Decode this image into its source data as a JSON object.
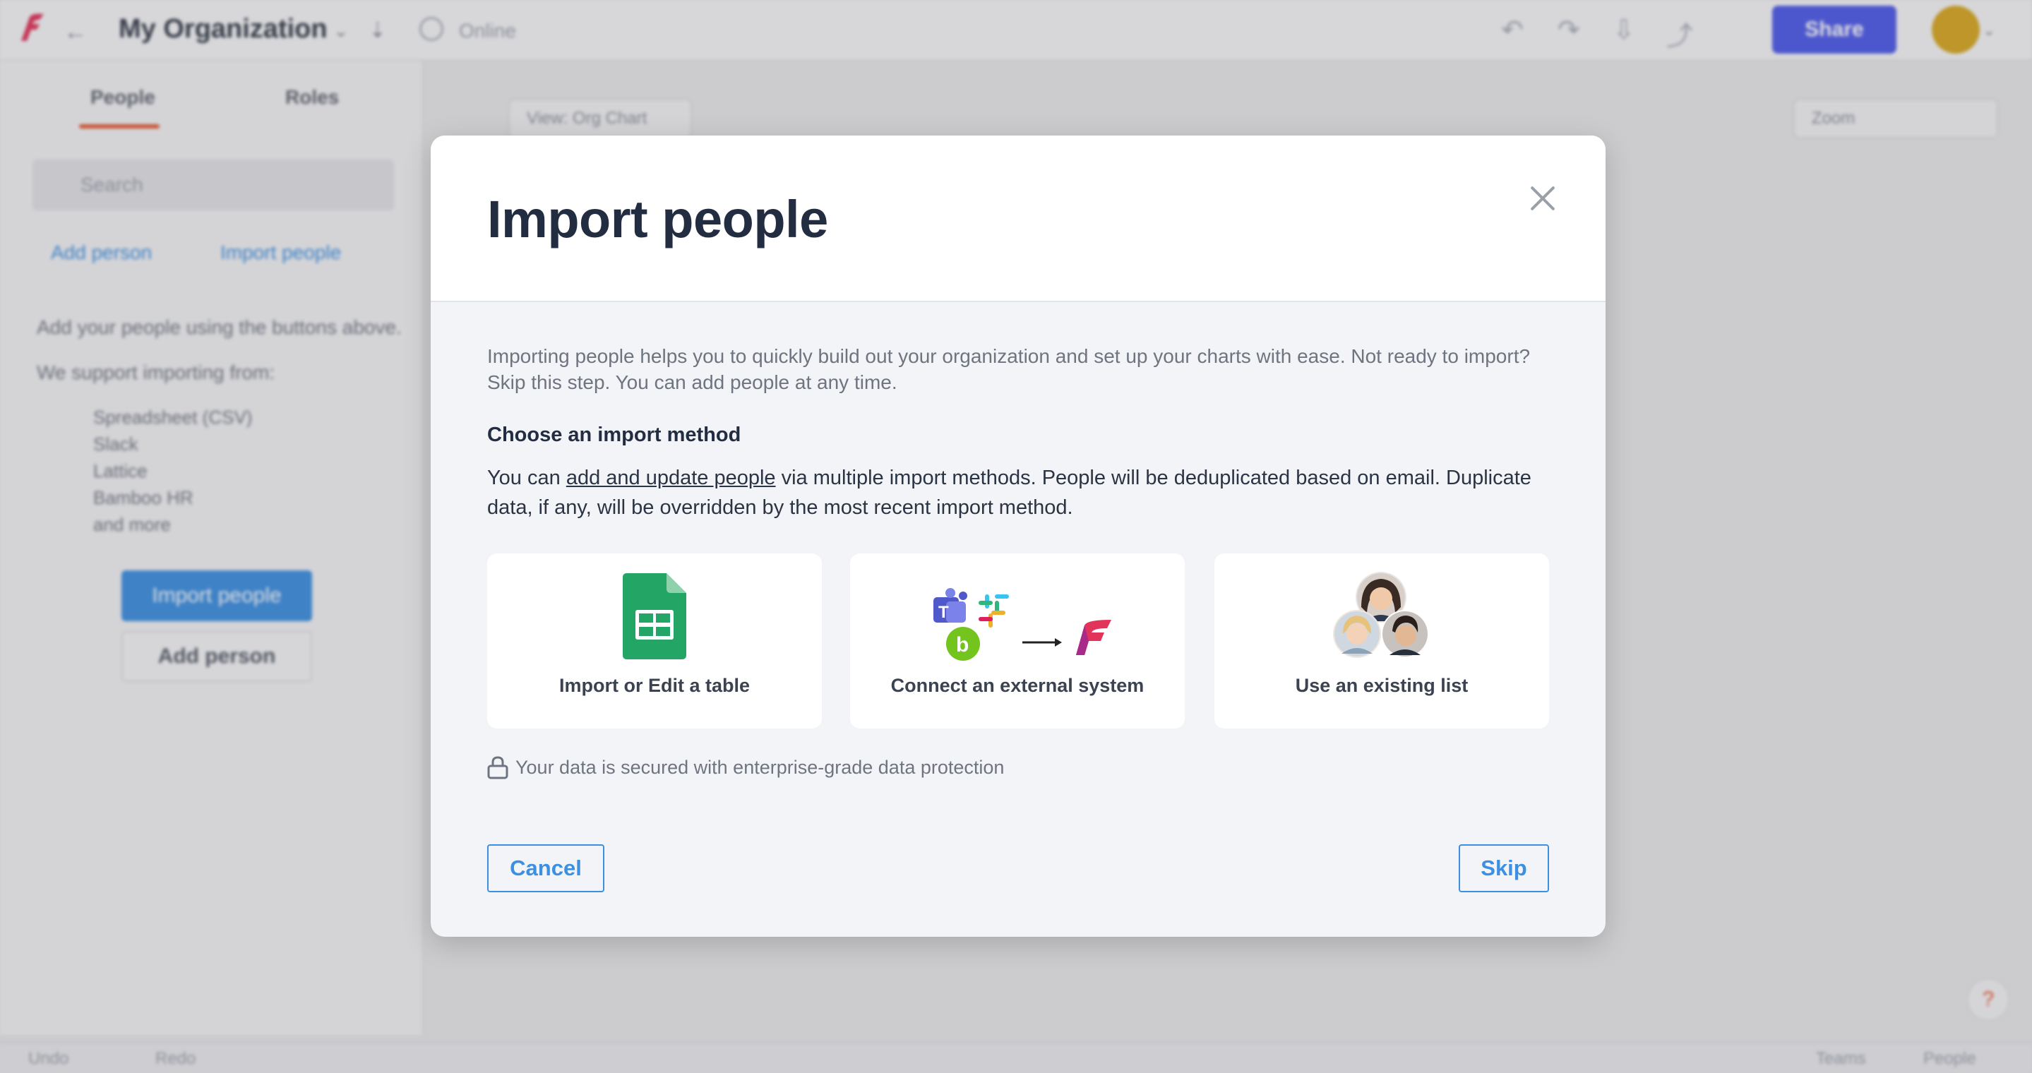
{
  "app": {
    "org_title": "My Organization",
    "online_label": "Online",
    "share_label": "Share",
    "sidebar_tabs": [
      "People",
      "Roles"
    ],
    "search_placeholder": "Search",
    "add_person_link": "Add person",
    "import_people_link": "Import people",
    "help_text_1": "Add your people using the buttons above.",
    "help_text_2": "We support importing from:",
    "import_sources": [
      "Spreadsheet (CSV)",
      "Slack",
      "Lattice",
      "Bamboo HR",
      "and more"
    ],
    "import_people_button": "Import people",
    "add_person_button": "Add person",
    "canvas_view": "View: Org Chart",
    "zoom_label": "Zoom",
    "status_left": [
      "Undo",
      "Redo"
    ],
    "status_right": [
      "Teams",
      "People"
    ]
  },
  "modal": {
    "title": "Import people",
    "intro": "Importing people helps you to quickly build out your organization and set up your charts with ease. Not ready to import? Skip this step. You can add people at any time.",
    "section_title": "Choose an import method",
    "desc_prefix": "You can ",
    "desc_link": "add and update people",
    "desc_suffix": " via multiple import methods. People will be deduplicated based on email. Duplicate data, if any, will be overridden by the most recent import method.",
    "cards": [
      {
        "label": "Import or Edit a table",
        "icon": "google-sheets-icon"
      },
      {
        "label": "Connect an external system",
        "icon": "integrations-icon"
      },
      {
        "label": "Use an existing list",
        "icon": "people-avatars-icon"
      }
    ],
    "security_note": "Your data is secured with enterprise-grade data protection",
    "cancel_label": "Cancel",
    "skip_label": "Skip"
  },
  "colors": {
    "accent": "#3d8fe0",
    "title": "#232d42",
    "share_button": "#4f5be8",
    "sheets_green": "#23a566"
  }
}
